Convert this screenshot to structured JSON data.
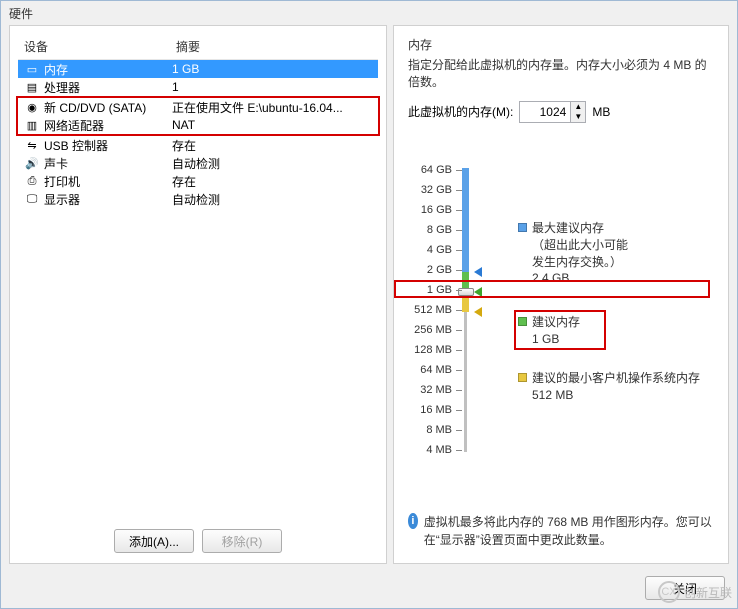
{
  "dialog": {
    "title": "硬件"
  },
  "deviceList": {
    "headers": {
      "device": "设备",
      "summary": "摘要"
    },
    "items": [
      {
        "icon": "memory-icon",
        "name": "内存",
        "summary": "1 GB",
        "selected": true
      },
      {
        "icon": "cpu-icon",
        "name": "处理器",
        "summary": "1"
      },
      {
        "icon": "cd-icon",
        "name": "新 CD/DVD (SATA)",
        "summary": "正在使用文件 E:\\ubuntu-16.04..."
      },
      {
        "icon": "network-icon",
        "name": "网络适配器",
        "summary": "NAT"
      },
      {
        "icon": "usb-icon",
        "name": "USB 控制器",
        "summary": "存在"
      },
      {
        "icon": "sound-icon",
        "name": "声卡",
        "summary": "自动检测"
      },
      {
        "icon": "printer-icon",
        "name": "打印机",
        "summary": "存在"
      },
      {
        "icon": "display-icon",
        "name": "显示器",
        "summary": "自动检测"
      }
    ]
  },
  "buttons": {
    "add": "添加(A)...",
    "remove": "移除(R)",
    "close": "关闭"
  },
  "memory": {
    "section": "内存",
    "desc": "指定分配给此虚拟机的内存量。内存大小必须为 4 MB 的倍数。",
    "label": "此虚拟机的内存(M):",
    "value": "1024",
    "unit": "MB",
    "scale": [
      "64 GB",
      "32 GB",
      "16 GB",
      "8 GB",
      "4 GB",
      "2 GB",
      "1 GB",
      "512 MB",
      "256 MB",
      "128 MB",
      "64 MB",
      "32 MB",
      "16 MB",
      "8 MB",
      "4 MB"
    ],
    "notes": {
      "max": {
        "title": "最大建议内存",
        "line1": "（超出此大小可能",
        "line2": "发生内存交换。）",
        "value": "2.4 GB"
      },
      "rec": {
        "title": "建议内存",
        "value": "1 GB"
      },
      "min": {
        "title": "建议的最小客户机操作系统内存",
        "value": "512 MB"
      }
    },
    "info": "虚拟机最多将此内存的 768 MB 用作图形内存。您可以在“显示器”设置页面中更改此数量。"
  },
  "watermark": {
    "brand": "创新互联"
  }
}
